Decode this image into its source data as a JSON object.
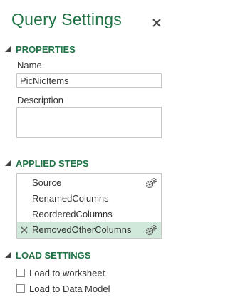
{
  "pane": {
    "title": "Query Settings",
    "close_icon": "close-icon",
    "accent_color": "#217346"
  },
  "properties": {
    "header": "PROPERTIES",
    "name_label": "Name",
    "name_value": "PicNicItems",
    "description_label": "Description",
    "description_value": ""
  },
  "applied_steps": {
    "header": "APPLIED STEPS",
    "steps": [
      {
        "label": "Source",
        "has_gear": true,
        "selected": false
      },
      {
        "label": "RenamedColumns",
        "has_gear": false,
        "selected": false
      },
      {
        "label": "ReorderedColumns",
        "has_gear": false,
        "selected": false
      },
      {
        "label": "RemovedOtherColumns",
        "has_gear": true,
        "selected": true
      }
    ],
    "selected_color": "#cfe8d9"
  },
  "load_settings": {
    "header": "LOAD SETTINGS",
    "options": [
      {
        "label": "Load to worksheet",
        "checked": false
      },
      {
        "label": "Load to Data Model",
        "checked": false
      }
    ]
  }
}
